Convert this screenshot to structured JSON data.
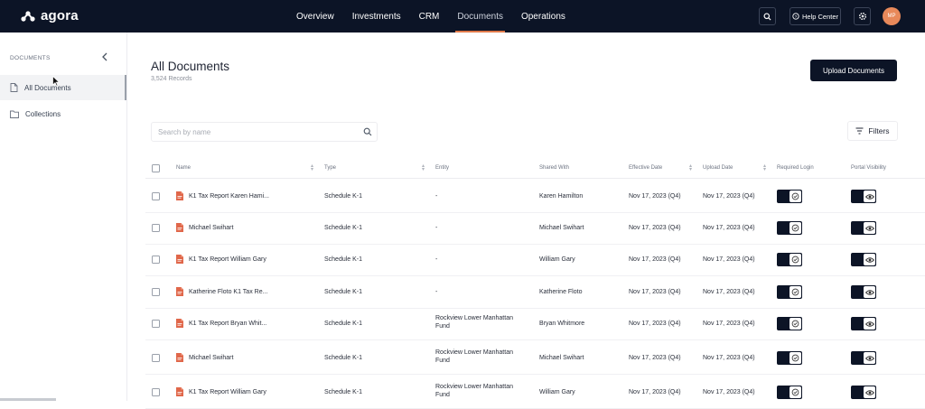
{
  "app": {
    "name": "agora"
  },
  "nav": [
    {
      "label": "Overview",
      "active": false
    },
    {
      "label": "Investments",
      "active": false
    },
    {
      "label": "CRM",
      "active": false
    },
    {
      "label": "Documents",
      "active": true
    },
    {
      "label": "Operations",
      "active": false
    }
  ],
  "topbar": {
    "help_label": "Help Center",
    "avatar_initials": "MP"
  },
  "sidebar": {
    "header": "DOCUMENTS",
    "items": [
      {
        "label": "All Documents",
        "icon": "file-icon",
        "active": true
      },
      {
        "label": "Collections",
        "icon": "folder-icon",
        "active": false
      }
    ]
  },
  "main": {
    "title": "All Documents",
    "records": "3,524 Records",
    "upload_label": "Upload Documents",
    "search_placeholder": "Search by name",
    "filters_label": "Filters"
  },
  "table": {
    "columns": [
      "Name",
      "Type",
      "Entity",
      "Shared With",
      "Effective Date",
      "Upload Date",
      "Required Login",
      "Portal Visibility"
    ],
    "rows": [
      {
        "name": "K1 Tax Report Karen Hami...",
        "type": "Schedule K-1",
        "entity": "-",
        "shared_with": "Karen Hamilton",
        "effective_date": "Nov 17, 2023 (Q4)",
        "upload_date": "Nov 17, 2023 (Q4)"
      },
      {
        "name": "Michael Swihart",
        "type": "Schedule K-1",
        "entity": "-",
        "shared_with": "Michael Swihart",
        "effective_date": "Nov 17, 2023 (Q4)",
        "upload_date": "Nov 17, 2023 (Q4)"
      },
      {
        "name": "K1 Tax Report William Gary",
        "type": "Schedule K-1",
        "entity": "-",
        "shared_with": "William Gary",
        "effective_date": "Nov 17, 2023 (Q4)",
        "upload_date": "Nov 17, 2023 (Q4)"
      },
      {
        "name": "Katherine Floto K1 Tax Re...",
        "type": "Schedule K-1",
        "entity": "-",
        "shared_with": "Katherine Floto",
        "effective_date": "Nov 17, 2023 (Q4)",
        "upload_date": "Nov 17, 2023 (Q4)"
      },
      {
        "name": "K1 Tax Report Bryan Whit...",
        "type": "Schedule K-1",
        "entity": "Rockview Lower Manhattan Fund",
        "shared_with": "Bryan Whitmore",
        "effective_date": "Nov 17, 2023 (Q4)",
        "upload_date": "Nov 17, 2023 (Q4)"
      },
      {
        "name": "Michael Swihart",
        "type": "Schedule K-1",
        "entity": "Rockview Lower Manhattan Fund",
        "shared_with": "Michael Swihart",
        "effective_date": "Nov 17, 2023 (Q4)",
        "upload_date": "Nov 17, 2023 (Q4)"
      },
      {
        "name": "K1 Tax Report William Gary",
        "type": "Schedule K-1",
        "entity": "Rockview Lower Manhattan Fund",
        "shared_with": "William Gary",
        "effective_date": "Nov 17, 2023 (Q4)",
        "upload_date": "Nov 17, 2023 (Q4)"
      }
    ]
  },
  "colors": {
    "navy": "#0c1426",
    "accent": "#e07a4a",
    "pdf": "#e0674a"
  }
}
